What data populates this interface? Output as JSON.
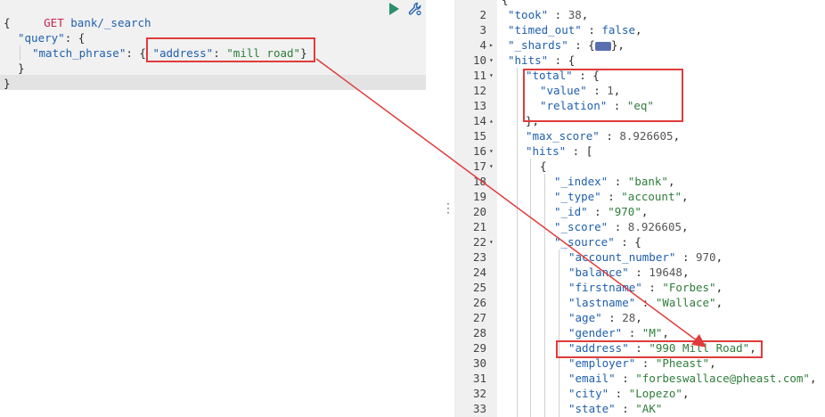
{
  "request": {
    "method": "GET",
    "path": "bank/_search",
    "lines": [
      {
        "k1": "{"
      },
      {
        "k2": "\"query\"",
        "p2": ": {"
      },
      {
        "k3": "\"match_phrase\"",
        "p3": ": { ",
        "k4": "\"address\"",
        "p4": ": ",
        "s4": "\"mill road\"",
        "e4": "}"
      },
      {
        "p5": "}"
      },
      {
        "p6": "}"
      }
    ]
  },
  "response": {
    "lines": [
      {
        "n": "2",
        "t": [
          [
            "k",
            "\"took\""
          ],
          [
            "p",
            " : "
          ],
          [
            "n",
            "38"
          ],
          [
            "p",
            ","
          ]
        ]
      },
      {
        "n": "3",
        "t": [
          [
            "k",
            "\"timed_out\""
          ],
          [
            "p",
            " : "
          ],
          [
            "b",
            "false"
          ],
          [
            "p",
            ","
          ]
        ]
      },
      {
        "n": "4",
        "t": [
          [
            "k",
            "\"_shards\""
          ],
          [
            "p",
            " : {"
          ],
          [
            "c",
            ""
          ],
          [
            "p",
            "},"
          ]
        ]
      },
      {
        "n": "10",
        "t": [
          [
            "k",
            "\"hits\""
          ],
          [
            "p",
            " : {"
          ]
        ]
      },
      {
        "n": "11",
        "t": [
          [
            "k",
            "\"total\""
          ],
          [
            "p",
            " : {"
          ]
        ]
      },
      {
        "n": "12",
        "t": [
          [
            "k",
            "\"value\""
          ],
          [
            "p",
            " : "
          ],
          [
            "n",
            "1"
          ],
          [
            "p",
            ","
          ]
        ]
      },
      {
        "n": "13",
        "t": [
          [
            "k",
            "\"relation\""
          ],
          [
            "p",
            " : "
          ],
          [
            "s",
            "\"eq\""
          ]
        ]
      },
      {
        "n": "14",
        "t": [
          [
            "p",
            "},"
          ]
        ]
      },
      {
        "n": "15",
        "t": [
          [
            "k",
            "\"max_score\""
          ],
          [
            "p",
            " : "
          ],
          [
            "n",
            "8.926605"
          ],
          [
            "p",
            ","
          ]
        ]
      },
      {
        "n": "16",
        "t": [
          [
            "k",
            "\"hits\""
          ],
          [
            "p",
            " : ["
          ]
        ]
      },
      {
        "n": "17",
        "t": [
          [
            "p",
            "{"
          ]
        ]
      },
      {
        "n": "18",
        "t": [
          [
            "k",
            "\"_index\""
          ],
          [
            "p",
            " : "
          ],
          [
            "s",
            "\"bank\""
          ],
          [
            "p",
            ","
          ]
        ]
      },
      {
        "n": "19",
        "t": [
          [
            "k",
            "\"_type\""
          ],
          [
            "p",
            " : "
          ],
          [
            "s",
            "\"account\""
          ],
          [
            "p",
            ","
          ]
        ]
      },
      {
        "n": "20",
        "t": [
          [
            "k",
            "\"_id\""
          ],
          [
            "p",
            " : "
          ],
          [
            "s",
            "\"970\""
          ],
          [
            "p",
            ","
          ]
        ]
      },
      {
        "n": "21",
        "t": [
          [
            "k",
            "\"_score\""
          ],
          [
            "p",
            " : "
          ],
          [
            "n",
            "8.926605"
          ],
          [
            "p",
            ","
          ]
        ]
      },
      {
        "n": "22",
        "t": [
          [
            "k",
            "\"_source\""
          ],
          [
            "p",
            " : {"
          ]
        ]
      },
      {
        "n": "23",
        "t": [
          [
            "k",
            "\"account_number\""
          ],
          [
            "p",
            " : "
          ],
          [
            "n",
            "970"
          ],
          [
            "p",
            ","
          ]
        ]
      },
      {
        "n": "24",
        "t": [
          [
            "k",
            "\"balance\""
          ],
          [
            "p",
            " : "
          ],
          [
            "n",
            "19648"
          ],
          [
            "p",
            ","
          ]
        ]
      },
      {
        "n": "25",
        "t": [
          [
            "k",
            "\"firstname\""
          ],
          [
            "p",
            " : "
          ],
          [
            "s",
            "\"Forbes\""
          ],
          [
            "p",
            ","
          ]
        ]
      },
      {
        "n": "26",
        "t": [
          [
            "k",
            "\"lastname\""
          ],
          [
            "p",
            " : "
          ],
          [
            "s",
            "\"Wallace\""
          ],
          [
            "p",
            ","
          ]
        ]
      },
      {
        "n": "27",
        "t": [
          [
            "k",
            "\"age\""
          ],
          [
            "p",
            " : "
          ],
          [
            "n",
            "28"
          ],
          [
            "p",
            ","
          ]
        ]
      },
      {
        "n": "28",
        "t": [
          [
            "k",
            "\"gender\""
          ],
          [
            "p",
            " : "
          ],
          [
            "s",
            "\"M\""
          ],
          [
            "p",
            ","
          ]
        ]
      },
      {
        "n": "29",
        "t": [
          [
            "k",
            "\"address\""
          ],
          [
            "p",
            " : "
          ],
          [
            "s",
            "\"990 Mill Road\""
          ],
          [
            "p",
            ","
          ]
        ]
      },
      {
        "n": "30",
        "t": [
          [
            "k",
            "\"employer\""
          ],
          [
            "p",
            " : "
          ],
          [
            "s",
            "\"Pheast\""
          ],
          [
            "p",
            ","
          ]
        ]
      },
      {
        "n": "31",
        "t": [
          [
            "k",
            "\"email\""
          ],
          [
            "p",
            " : "
          ],
          [
            "s",
            "\"forbeswallace@pheast.com\""
          ],
          [
            "p",
            ","
          ]
        ]
      },
      {
        "n": "32",
        "t": [
          [
            "k",
            "\"city\""
          ],
          [
            "p",
            " : "
          ],
          [
            "s",
            "\"Lopezo\""
          ],
          [
            "p",
            ","
          ]
        ]
      },
      {
        "n": "33",
        "t": [
          [
            "k",
            "\"state\""
          ],
          [
            "p",
            " : "
          ],
          [
            "s",
            "\"AK\""
          ]
        ]
      }
    ],
    "first_line_brace": "{"
  },
  "colors": {
    "highlight": "#e03b3b",
    "play": "#2a8f6f"
  }
}
